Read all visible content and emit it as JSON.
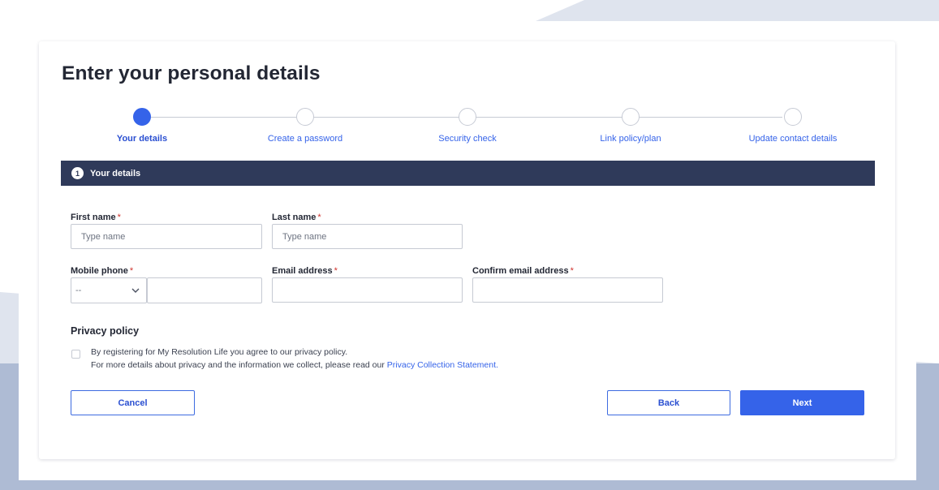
{
  "page": {
    "title": "Enter your personal details"
  },
  "stepper": {
    "steps": [
      {
        "label": "Your details",
        "active": true
      },
      {
        "label": "Create a password",
        "active": false
      },
      {
        "label": "Security check",
        "active": false
      },
      {
        "label": "Link policy/plan",
        "active": false
      },
      {
        "label": "Update contact details",
        "active": false
      }
    ]
  },
  "section": {
    "number": "1",
    "title": "Your details"
  },
  "form": {
    "required_mark": "*",
    "first_name": {
      "label": "First name",
      "placeholder": "Type name",
      "value": ""
    },
    "last_name": {
      "label": "Last name",
      "placeholder": "Type name",
      "value": ""
    },
    "mobile_phone": {
      "label": "Mobile phone",
      "country_code": "--",
      "value": ""
    },
    "email": {
      "label": "Email address",
      "value": ""
    },
    "confirm_email": {
      "label": "Confirm email address",
      "value": ""
    }
  },
  "privacy": {
    "heading": "Privacy policy",
    "line1": "By registering for My Resolution Life you agree to our privacy policy.",
    "line2_prefix": "For more details about privacy and the information we collect, please read our ",
    "link_text": "Privacy Collection Statement",
    "line2_suffix": ".",
    "checked": false
  },
  "buttons": {
    "cancel": "Cancel",
    "back": "Back",
    "next": "Next"
  },
  "colors": {
    "accent": "#3563e9",
    "header_bar": "#2f3a5a",
    "required": "#d0322c"
  }
}
